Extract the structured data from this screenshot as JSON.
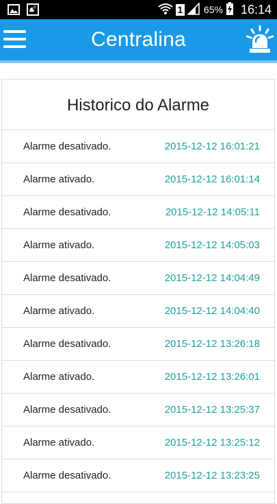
{
  "status_bar": {
    "battery_percent": "65%",
    "sim_label": "1",
    "time": "16:14",
    "icons": [
      "gallery-icon",
      "voicemail-icon",
      "wifi-icon",
      "signal-icon",
      "battery-charging-icon"
    ]
  },
  "app_bar": {
    "title": "Centralina",
    "menu_icon": "menu-icon",
    "action_icon": "siren-icon",
    "color": "#1a9ae6"
  },
  "history": {
    "title": "Historico do Alarme",
    "timestamp_color": "#1aa39a",
    "entries": [
      {
        "message": "Alarme desativado.",
        "timestamp": "2015-12-12 16:01:21"
      },
      {
        "message": "Alarme ativado.",
        "timestamp": "2015-12-12 16:01:14"
      },
      {
        "message": "Alarme desativado.",
        "timestamp": "2015-12-12 14:05:11"
      },
      {
        "message": "Alarme ativado.",
        "timestamp": "2015-12-12 14:05:03"
      },
      {
        "message": "Alarme desativado.",
        "timestamp": "2015-12-12 14:04:49"
      },
      {
        "message": "Alarme ativado.",
        "timestamp": "2015-12-12 14:04:40"
      },
      {
        "message": "Alarme desativado.",
        "timestamp": "2015-12-12 13:26:18"
      },
      {
        "message": "Alarme ativado.",
        "timestamp": "2015-12-12 13:26:01"
      },
      {
        "message": "Alarme desativado.",
        "timestamp": "2015-12-12 13:25:37"
      },
      {
        "message": "Alarme ativado.",
        "timestamp": "2015-12-12 13:25:12"
      },
      {
        "message": "Alarme desativado.",
        "timestamp": "2015-12-12 13:23:25"
      }
    ]
  }
}
